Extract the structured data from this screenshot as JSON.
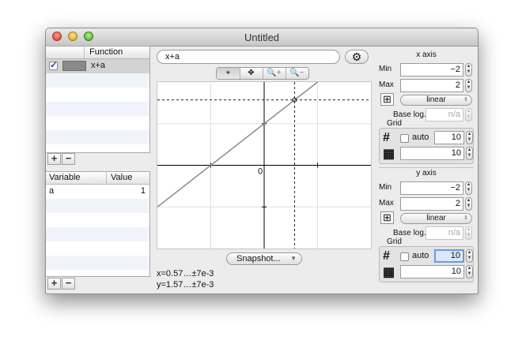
{
  "window": {
    "title": "Untitled"
  },
  "functions": {
    "header": "Function",
    "rows": [
      {
        "checked": true,
        "name": "x+a",
        "color": "#8a8a8a"
      }
    ]
  },
  "variables": {
    "header_variable": "Variable",
    "header_value": "Value",
    "rows": [
      {
        "name": "a",
        "value": "1"
      }
    ]
  },
  "buttons": {
    "add": "+",
    "remove": "−"
  },
  "expression": {
    "value": "x+a",
    "settings_icon": "gear-icon"
  },
  "tools": [
    {
      "icon": "crosshair-icon",
      "label": "⌖",
      "selected": true
    },
    {
      "icon": "move-icon",
      "label": "✥",
      "selected": false
    },
    {
      "icon": "zoom-in-icon",
      "label": "🔍+",
      "selected": false
    },
    {
      "icon": "zoom-out-icon",
      "label": "🔍−",
      "selected": false
    }
  ],
  "plot": {
    "origin_label": "0",
    "function": "x+a",
    "xlim": [
      -2,
      2
    ],
    "ylim": [
      -2,
      2
    ],
    "cursor": {
      "x": 0.57,
      "y": 1.57
    },
    "line_color": "#909090"
  },
  "snapshot": {
    "label": "Snapshot..."
  },
  "coords": {
    "x": "x=0.57…±7e-3",
    "y": "y=1.57…±7e-3"
  },
  "x_axis": {
    "title": "x axis",
    "min_label": "Min",
    "min": "−2",
    "max_label": "Max",
    "max": "2",
    "scale": "linear",
    "base_log_label": "Base log.",
    "base_log": "n/a",
    "grid_label": "Grid",
    "auto_label": "auto",
    "major": "10",
    "minor": "10"
  },
  "y_axis": {
    "title": "y axis",
    "min_label": "Min",
    "min": "−2",
    "max_label": "Max",
    "max": "2",
    "scale": "linear",
    "base_log_label": "Base log.",
    "base_log": "n/a",
    "grid_label": "Grid",
    "auto_label": "auto",
    "major": "10",
    "minor": "10"
  }
}
